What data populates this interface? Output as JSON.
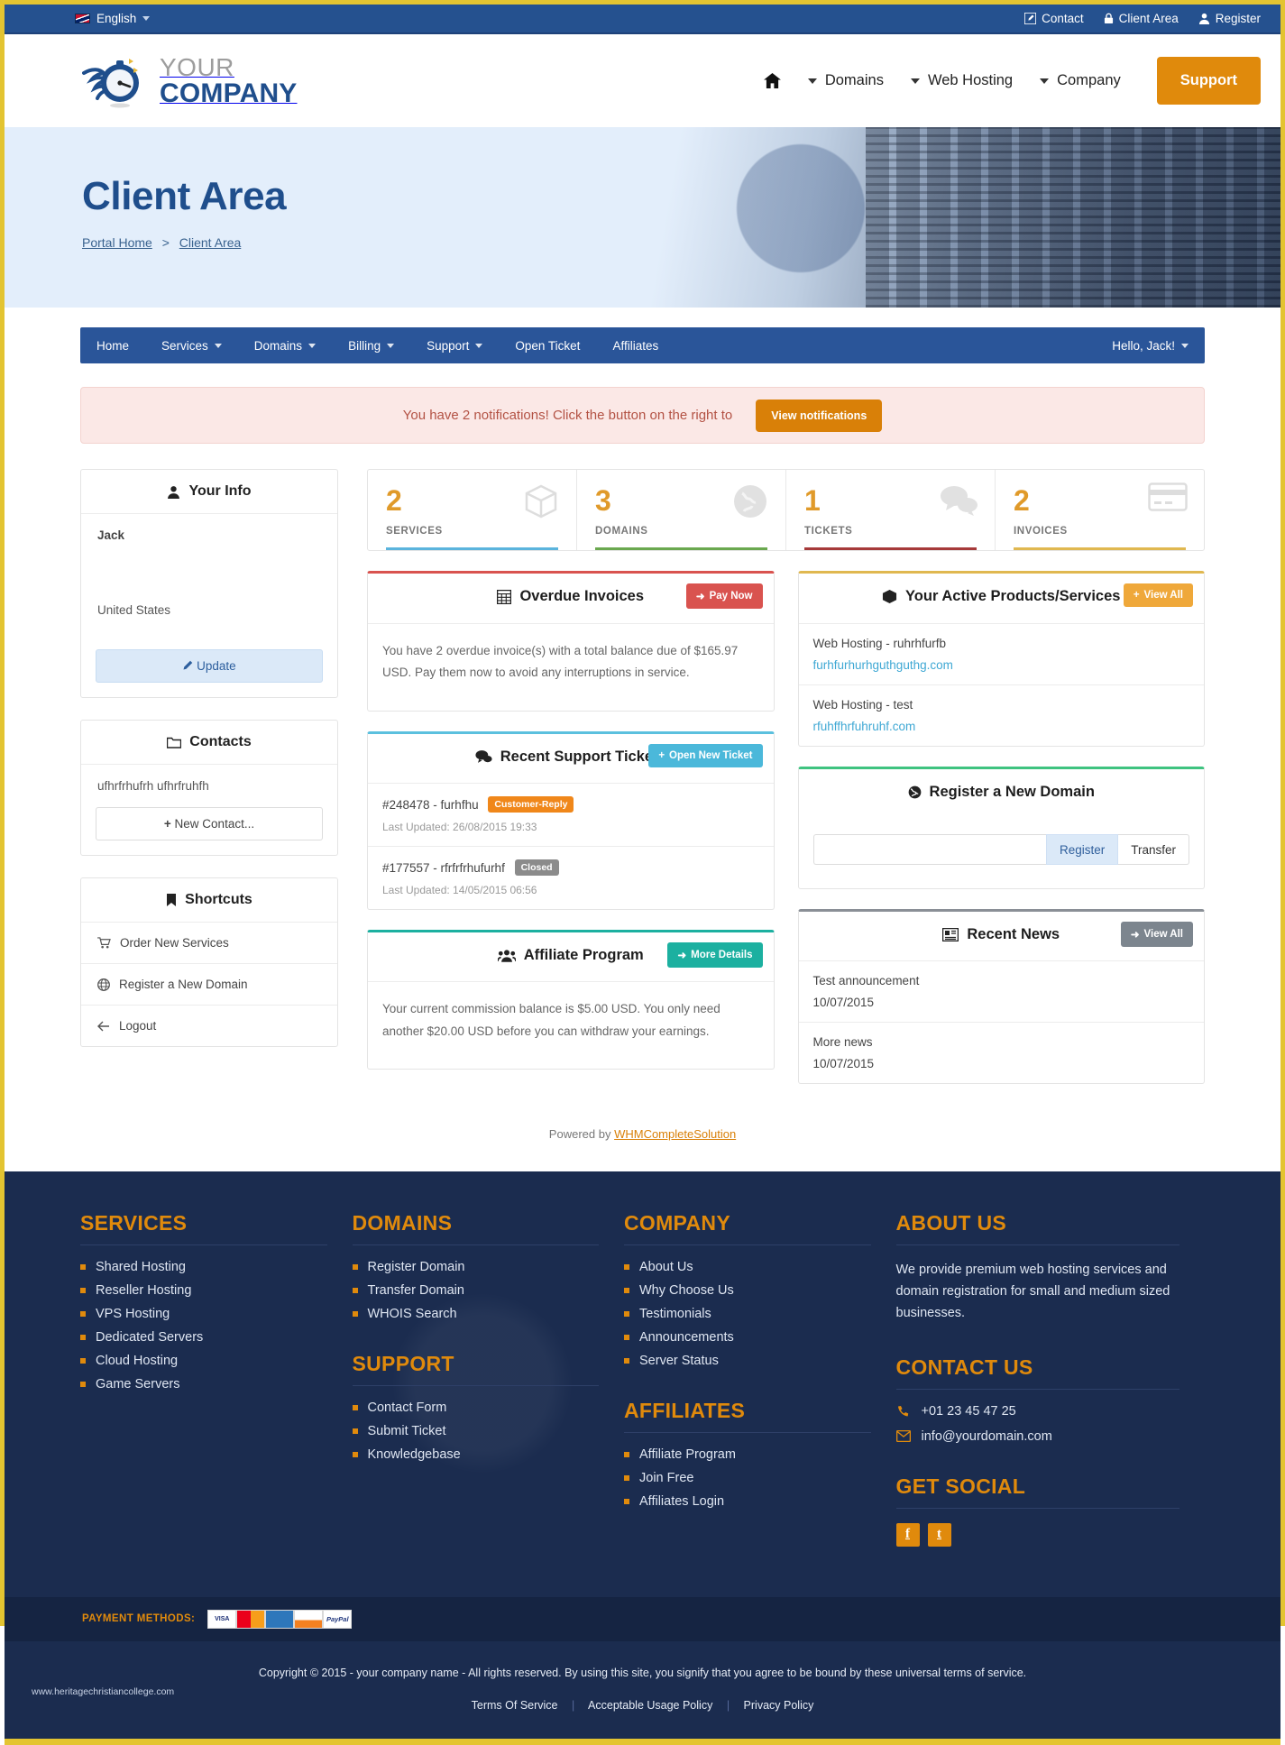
{
  "topbar": {
    "language": "English",
    "links": [
      {
        "label": "Contact",
        "icon": "pencil-square-icon"
      },
      {
        "label": "Client Area",
        "icon": "lock-icon"
      },
      {
        "label": "Register",
        "icon": "user-icon"
      }
    ]
  },
  "brand": {
    "line1": "YOUR",
    "line2": "COMPANY"
  },
  "mainnav": {
    "home_icon": "home-icon",
    "items": [
      {
        "label": "Domains",
        "caret": true
      },
      {
        "label": "Web Hosting",
        "caret": true
      },
      {
        "label": "Company",
        "caret": true
      }
    ],
    "support_label": "Support"
  },
  "hero": {
    "title": "Client Area",
    "breadcrumb": {
      "home": "Portal Home",
      "sep": ">",
      "current": "Client Area"
    }
  },
  "clientnav": {
    "items": [
      {
        "label": "Home",
        "caret": false
      },
      {
        "label": "Services",
        "caret": true
      },
      {
        "label": "Domains",
        "caret": true
      },
      {
        "label": "Billing",
        "caret": true
      },
      {
        "label": "Support",
        "caret": true
      },
      {
        "label": "Open Ticket",
        "caret": false
      },
      {
        "label": "Affiliates",
        "caret": false
      }
    ],
    "greeting": "Hello, Jack!"
  },
  "notification": {
    "text": "You have 2 notifications! Click the button on the right to",
    "button": "View notifications"
  },
  "your_info": {
    "title": "Your Info",
    "icon": "user-icon",
    "name": "Jack",
    "country": "United States",
    "update_label": "Update"
  },
  "contacts": {
    "title": "Contacts",
    "icon": "folder-icon",
    "entry": "ufhrfrhufrh ufhrfruhfh",
    "new_label": "New Contact..."
  },
  "shortcuts": {
    "title": "Shortcuts",
    "icon": "bookmark-icon",
    "items": [
      {
        "label": "Order New Services",
        "icon": "cart-icon"
      },
      {
        "label": "Register a New Domain",
        "icon": "globe-icon"
      },
      {
        "label": "Logout",
        "icon": "arrow-left-icon"
      }
    ]
  },
  "stats": [
    {
      "value": "2",
      "label": "SERVICES",
      "icon": "box-icon",
      "color": "#5bb4dd"
    },
    {
      "value": "3",
      "label": "DOMAINS",
      "icon": "globe-icon",
      "color": "#6aa84f"
    },
    {
      "value": "1",
      "label": "TICKETS",
      "icon": "comments-icon",
      "color": "#a63a3a"
    },
    {
      "value": "2",
      "label": "INVOICES",
      "icon": "credit-card-icon",
      "color": "#e0b850"
    }
  ],
  "overdue_invoices": {
    "title": "Overdue Invoices",
    "icon": "calculator-icon",
    "button": "Pay Now",
    "button_icon": "arrow-right-icon",
    "accent": "#d9534f",
    "body": "You have 2 overdue invoice(s) with a total balance due of $165.97 USD. Pay them now to avoid any interruptions in service."
  },
  "support_tickets": {
    "title": "Recent Support Tickets",
    "icon": "comments-icon",
    "button": "Open New Ticket",
    "button_icon": "plus-icon",
    "accent": "#5bc0de",
    "rows": [
      {
        "title": "#248478 - furhfhu",
        "badge": "Customer-Reply",
        "badge_color": "#f0871a",
        "updated": "Last Updated: 26/08/2015 19:33"
      },
      {
        "title": "#177557 - rfrfrfrhufurhf",
        "badge": "Closed",
        "badge_color": "#8b8b8b",
        "updated": "Last Updated: 14/05/2015 06:56"
      }
    ]
  },
  "affiliate": {
    "title": "Affiliate Program",
    "icon": "users-icon",
    "button": "More Details",
    "button_icon": "arrow-right-icon",
    "accent": "#1cb0a0",
    "body": "Your current commission balance is $5.00 USD. You only need another $20.00 USD before you can withdraw your earnings."
  },
  "active_products": {
    "title": "Your Active Products/Services",
    "icon": "box-icon",
    "button": "View All",
    "button_icon": "plus-icon",
    "button_color": "#efa83a",
    "accent": "#e0b850",
    "rows": [
      {
        "name": "Web Hosting - ruhrhfurfb",
        "domain": "furhfurhurhguthguthg.com"
      },
      {
        "name": "Web Hosting - test",
        "domain": "rfuhffhrfuhruhf.com"
      }
    ]
  },
  "register_domain": {
    "title": "Register a New Domain",
    "icon": "globe-icon",
    "accent": "#3fc380",
    "input_value": "",
    "input_placeholder": "",
    "register_label": "Register",
    "transfer_label": "Transfer"
  },
  "recent_news": {
    "title": "Recent News",
    "icon": "newspaper-icon",
    "button": "View All",
    "button_icon": "arrow-right-icon",
    "button_color": "#7c858e",
    "accent": "#8a8f96",
    "rows": [
      {
        "title": "Test announcement",
        "date": "10/07/2015"
      },
      {
        "title": "More news",
        "date": "10/07/2015"
      }
    ]
  },
  "powered": {
    "prefix": "Powered by",
    "link": "WHMCompleteSolution"
  },
  "footer": {
    "services": {
      "heading": "SERVICES",
      "items": [
        "Shared Hosting",
        "Reseller Hosting",
        "VPS Hosting",
        "Dedicated Servers",
        "Cloud Hosting",
        "Game Servers"
      ]
    },
    "domains": {
      "heading": "DOMAINS",
      "items": [
        "Register Domain",
        "Transfer Domain",
        "WHOIS Search"
      ]
    },
    "support": {
      "heading": "SUPPORT",
      "items": [
        "Contact Form",
        "Submit Ticket",
        "Knowledgebase"
      ]
    },
    "company": {
      "heading": "COMPANY",
      "items": [
        "About Us",
        "Why Choose Us",
        "Testimonials",
        "Announcements",
        "Server Status"
      ]
    },
    "affiliates": {
      "heading": "AFFILIATES",
      "items": [
        "Affiliate Program",
        "Join Free",
        "Affiliates Login"
      ]
    },
    "about": {
      "heading": "ABOUT US",
      "text": "We provide premium web hosting services and domain registration for small and medium sized businesses."
    },
    "contact": {
      "heading": "CONTACT US",
      "phone": "+01 23 45 47 25",
      "email": "info@yourdomain.com"
    },
    "social": {
      "heading": "GET SOCIAL",
      "items": [
        {
          "name": "facebook-icon",
          "glyph": "f"
        },
        {
          "name": "twitter-icon",
          "glyph": "t"
        }
      ]
    },
    "payment": {
      "label": "PAYMENT METHODS:",
      "cards": [
        "VISA",
        "MasterCard",
        "AMERICAN EXPRESS",
        "DISCOVER",
        "PayPal"
      ]
    },
    "copyright": "Copyright © 2015 - your company name - All rights reserved. By using this site, you signify that you agree to be bound by these universal terms of service.",
    "legal": [
      "Terms Of Service",
      "Acceptable Usage Policy",
      "Privacy Policy"
    ],
    "watermark": "www.heritagechristiancollege.com"
  }
}
